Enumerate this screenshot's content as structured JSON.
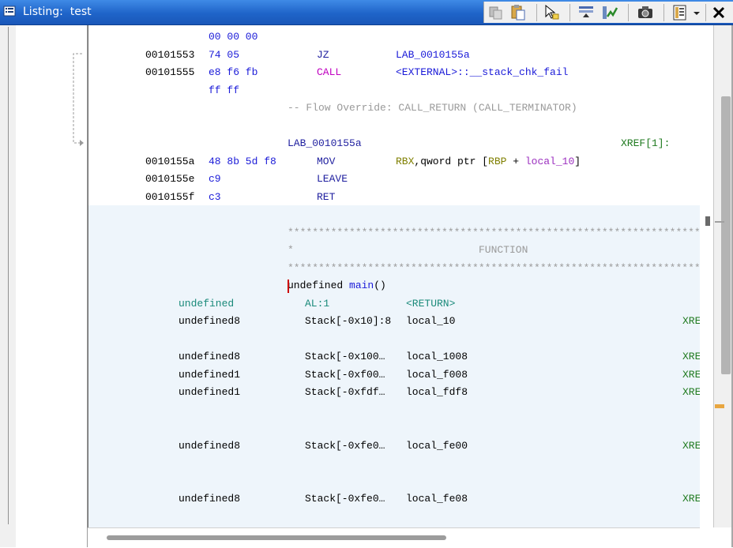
{
  "window": {
    "title": "Listing:  test"
  },
  "toolbar": {
    "buttons": [
      {
        "name": "copy-icon"
      },
      {
        "name": "paste-icon"
      },
      {
        "name": "cursor-select-icon"
      },
      {
        "name": "field-expand-icon"
      },
      {
        "name": "diff-icon"
      },
      {
        "name": "snapshot-icon"
      },
      {
        "name": "layout-icon"
      },
      {
        "name": "dropdown-icon"
      },
      {
        "name": "close-icon"
      }
    ]
  },
  "listing": {
    "lines": [
      {
        "bytes": "00 00 00"
      },
      {
        "addr": "00101553",
        "bytes": "74 05",
        "mnemonic": "JZ",
        "operand": "LAB_0010155a"
      },
      {
        "addr": "00101555",
        "bytes": "e8 f6 fb",
        "mnemonic": "CALL",
        "operand": "<EXTERNAL>::__stack_chk_fail"
      },
      {
        "bytes": "ff ff"
      },
      {
        "comment": "-- Flow Override: CALL_RETURN (CALL_TERMINATOR)"
      },
      {
        "label": "LAB_0010155a",
        "xref": "XREF[1]:"
      },
      {
        "addr": "0010155a",
        "bytes": "48 8b 5d f8",
        "mnemonic": "MOV",
        "op_reg1": "RBX",
        "op_mid": ",qword ptr [",
        "op_reg2": "RBP",
        "op_plus": " + ",
        "op_var": "local_10",
        "op_end": "]"
      },
      {
        "addr": "0010155e",
        "bytes": "c9",
        "mnemonic": "LEAVE"
      },
      {
        "addr": "0010155f",
        "bytes": "c3",
        "mnemonic": "RET"
      }
    ],
    "function": {
      "stars": "******************************************************************************************",
      "header_star": "*",
      "header_label": "FUNCTION",
      "signature_type": "undefined",
      "signature_name": "main",
      "signature_args": "()",
      "vars": [
        {
          "type": "undefined",
          "loc": "AL:1",
          "name": "<RETURN>",
          "xref": ""
        },
        {
          "type": "undefined8",
          "loc": "Stack[-0x10]:8",
          "name": "local_10",
          "xref": "XRE"
        },
        {
          "type": "undefined8",
          "loc": "Stack[-0x100…",
          "name": "local_1008",
          "xref": "XRE"
        },
        {
          "type": "undefined1",
          "loc": "Stack[-0xf00…",
          "name": "local_f008",
          "xref": "XRE"
        },
        {
          "type": "undefined1",
          "loc": "Stack[-0xfdf…",
          "name": "local_fdf8",
          "xref": "XRE"
        },
        {
          "type": "undefined8",
          "loc": "Stack[-0xfe0…",
          "name": "local_fe00",
          "xref": "XRE"
        },
        {
          "type": "undefined8",
          "loc": "Stack[-0xfe0…",
          "name": "local_fe08",
          "xref": "XRE"
        }
      ]
    }
  },
  "colors": {
    "titlebar": "#1f64c9",
    "function_bg": "#eef5fb",
    "cursor": "#cc0000",
    "bytes": "#1a1ad8",
    "call": "#c000c0",
    "xref": "#1f7a1f"
  }
}
